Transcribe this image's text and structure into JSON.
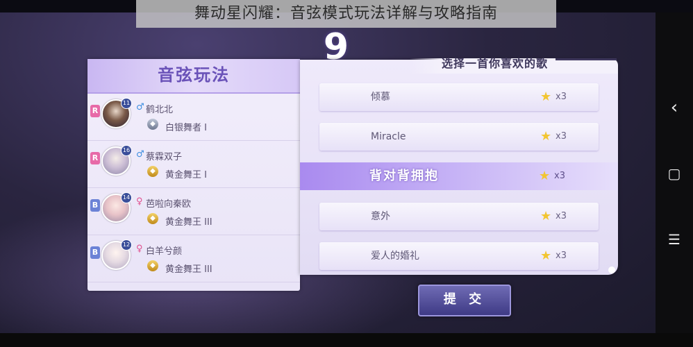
{
  "caption": "舞动星闪耀：音弦模式玩法详解与攻略指南",
  "round": "9",
  "left_panel": {
    "title": "音弦玩法",
    "players": [
      {
        "rank_badge": "R",
        "level": "11",
        "gender": "male",
        "gender_symbol": "♂",
        "name": "鹤北北",
        "rank": "白银舞者 I",
        "rank_tier": "silver"
      },
      {
        "rank_badge": "R",
        "level": "16",
        "gender": "male",
        "gender_symbol": "♂",
        "name": "蔡霖双子",
        "rank": "黄金舞王 I",
        "rank_tier": "gold"
      },
      {
        "rank_badge": "B",
        "level": "14",
        "gender": "female",
        "gender_symbol": "♀",
        "name": "芭啦向秦欧",
        "rank": "黄金舞王 III",
        "rank_tier": "gold"
      },
      {
        "rank_badge": "B",
        "level": "12",
        "gender": "female",
        "gender_symbol": "♀",
        "name": "白羊兮颜",
        "rank": "黄金舞王 III",
        "rank_tier": "gold"
      }
    ]
  },
  "right_panel": {
    "header": "选择一首你喜欢的歌",
    "songs": [
      {
        "name": "倾慕",
        "multiplier": "x3",
        "selected": false
      },
      {
        "name": "Miracle",
        "multiplier": "x3",
        "selected": false
      },
      {
        "name": "背对背拥抱",
        "multiplier": "x3",
        "selected": true
      },
      {
        "name": "意外",
        "multiplier": "x3",
        "selected": false
      },
      {
        "name": "爱人的婚礼",
        "multiplier": "x3",
        "selected": false
      }
    ]
  },
  "submit_label": "提 交",
  "nav": {
    "back": "‹",
    "home": "▢",
    "menu": "☰"
  },
  "icons": {
    "star": "★",
    "rank_silver": "◆",
    "rank_gold": "◆"
  },
  "colors": {
    "accent": "#a98aef",
    "star": "#f2c531",
    "male": "#3f8fe0",
    "female": "#e0518f"
  }
}
